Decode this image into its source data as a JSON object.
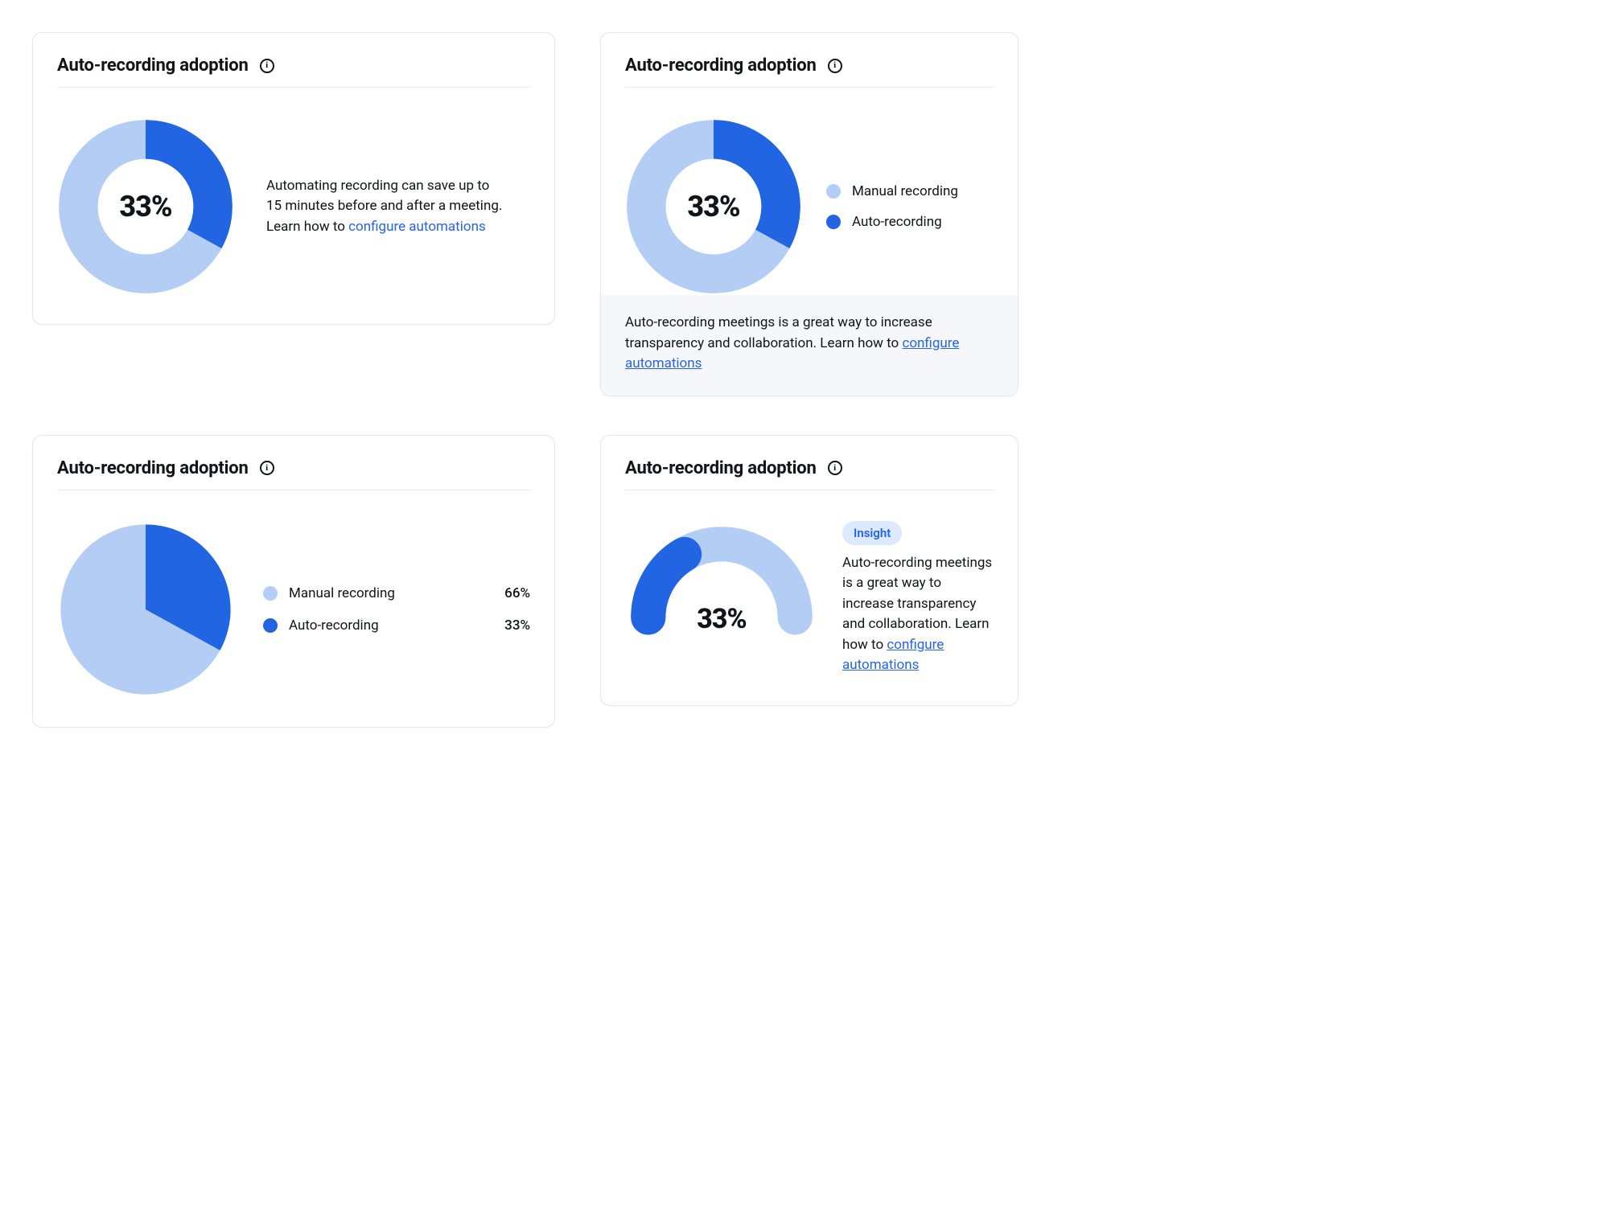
{
  "colors": {
    "light": "#b3cdf5",
    "dark": "#2265e3"
  },
  "card1": {
    "title": "Auto-recording adoption",
    "percent_label": "33%",
    "desc_prefix": "Automating recording can save up to 15 minutes before and after a meeting. Learn how to ",
    "link_text": "configure automations"
  },
  "card2": {
    "title": "Auto-recording adoption",
    "percent_label": "33%",
    "legend": {
      "manual": "Manual recording",
      "auto": "Auto-recording"
    },
    "footer_prefix": "Auto-recording meetings is a great way to increase transparency and collaboration. Learn how to ",
    "link_text": "configure automations"
  },
  "card3": {
    "title": "Auto-recording adoption",
    "rows": [
      {
        "label": "Manual recording",
        "value": "66%"
      },
      {
        "label": "Auto-recording",
        "value": "33%"
      }
    ]
  },
  "card4": {
    "title": "Auto-recording adoption",
    "percent_label": "33%",
    "badge": "Insight",
    "desc_prefix": "Auto-recording meetings is a great way to increase transparency and collaboration. Learn how to ",
    "link_text": "configure automations"
  },
  "chart_data": [
    {
      "type": "pie",
      "title": "Auto-recording adoption",
      "style": "donut",
      "series": [
        {
          "name": "Manual recording",
          "value": 67,
          "color": "#b3cdf5"
        },
        {
          "name": "Auto-recording",
          "value": 33,
          "color": "#2265e3"
        }
      ],
      "center_label": "33%"
    },
    {
      "type": "pie",
      "title": "Auto-recording adoption",
      "style": "donut",
      "series": [
        {
          "name": "Manual recording",
          "value": 67,
          "color": "#b3cdf5"
        },
        {
          "name": "Auto-recording",
          "value": 33,
          "color": "#2265e3"
        }
      ],
      "center_label": "33%"
    },
    {
      "type": "pie",
      "title": "Auto-recording adoption",
      "style": "solid",
      "series": [
        {
          "name": "Manual recording",
          "value": 66,
          "color": "#b3cdf5"
        },
        {
          "name": "Auto-recording",
          "value": 33,
          "color": "#2265e3"
        }
      ]
    },
    {
      "type": "pie",
      "title": "Auto-recording adoption",
      "style": "gauge",
      "series": [
        {
          "name": "Auto-recording",
          "value": 33,
          "color": "#2265e3"
        },
        {
          "name": "Manual recording",
          "value": 67,
          "color": "#b3cdf5"
        }
      ],
      "center_label": "33%",
      "range": [
        0,
        100
      ]
    }
  ]
}
